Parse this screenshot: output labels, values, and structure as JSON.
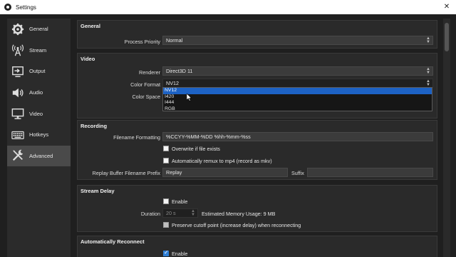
{
  "window": {
    "title": "Settings",
    "close_glyph": "✕"
  },
  "sidebar": {
    "items": [
      {
        "label": "General",
        "icon": "gear-icon"
      },
      {
        "label": "Stream",
        "icon": "antenna-icon"
      },
      {
        "label": "Output",
        "icon": "output-icon"
      },
      {
        "label": "Audio",
        "icon": "speaker-icon"
      },
      {
        "label": "Video",
        "icon": "monitor-icon"
      },
      {
        "label": "Hotkeys",
        "icon": "keyboard-icon"
      },
      {
        "label": "Advanced",
        "icon": "tools-icon",
        "active": true
      }
    ]
  },
  "general": {
    "title": "General",
    "process_priority_label": "Process Priority",
    "process_priority_value": "Normal"
  },
  "video": {
    "title": "Video",
    "renderer_label": "Renderer",
    "renderer_value": "Direct3D 11",
    "color_format_label": "Color Format",
    "color_format_value": "NV12",
    "color_space_label": "Color Space",
    "color_format_options": [
      "NV12",
      "I420",
      "I444",
      "RGB"
    ]
  },
  "recording": {
    "title": "Recording",
    "filename_label": "Filename Formatting",
    "filename_value": "%CCYY-%MM-%DD %hh-%mm-%ss",
    "overwrite_label": "Overwrite if file exists",
    "remux_label": "Automatically remux to mp4 (record as mkv)",
    "replay_prefix_label": "Replay Buffer Filename Prefix",
    "replay_prefix_value": "Replay",
    "suffix_label": "Suffix",
    "suffix_value": ""
  },
  "stream_delay": {
    "title": "Stream Delay",
    "enable_label": "Enable",
    "duration_label": "Duration",
    "duration_value": "20 s",
    "memory_usage": "Estimated Memory Usage: 9 MB",
    "preserve_label": "Preserve cutoff point (increase delay) when reconnecting"
  },
  "reconnect": {
    "title": "Automatically Reconnect",
    "enable_label": "Enable"
  },
  "colors": {
    "selection": "#1d62c4",
    "checkbox_checked": "#2f7fd6",
    "background": "#1f1f1f",
    "panel": "#2a2a2a"
  }
}
